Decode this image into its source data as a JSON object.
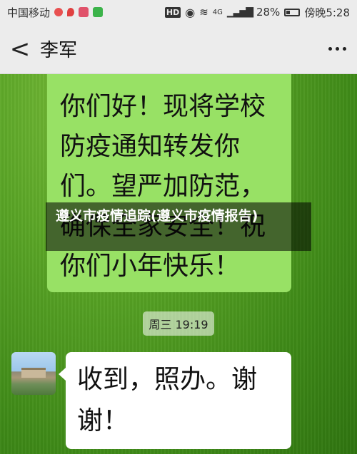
{
  "status_bar": {
    "carrier": "中国移动",
    "network": "HD",
    "signal": "4G",
    "battery": "28%",
    "time": "傍晚5:28"
  },
  "nav": {
    "back_glyph": "<",
    "contact_name": "李军"
  },
  "messages": {
    "sent": {
      "text": "你们好！现将学校防疫通知转发你们。望严加防范，确保全家安全！祝你们小年快乐！"
    },
    "timestamp": "周三 19:19",
    "received": {
      "text": "收到，照办。谢谢！"
    }
  },
  "overlay": {
    "headline": "遵义市疫情追踪(遵义市疫情报告)"
  },
  "colors": {
    "sent_bubble": "#98e165",
    "received_bubble": "#ffffff",
    "bar_background": "#ececec"
  }
}
